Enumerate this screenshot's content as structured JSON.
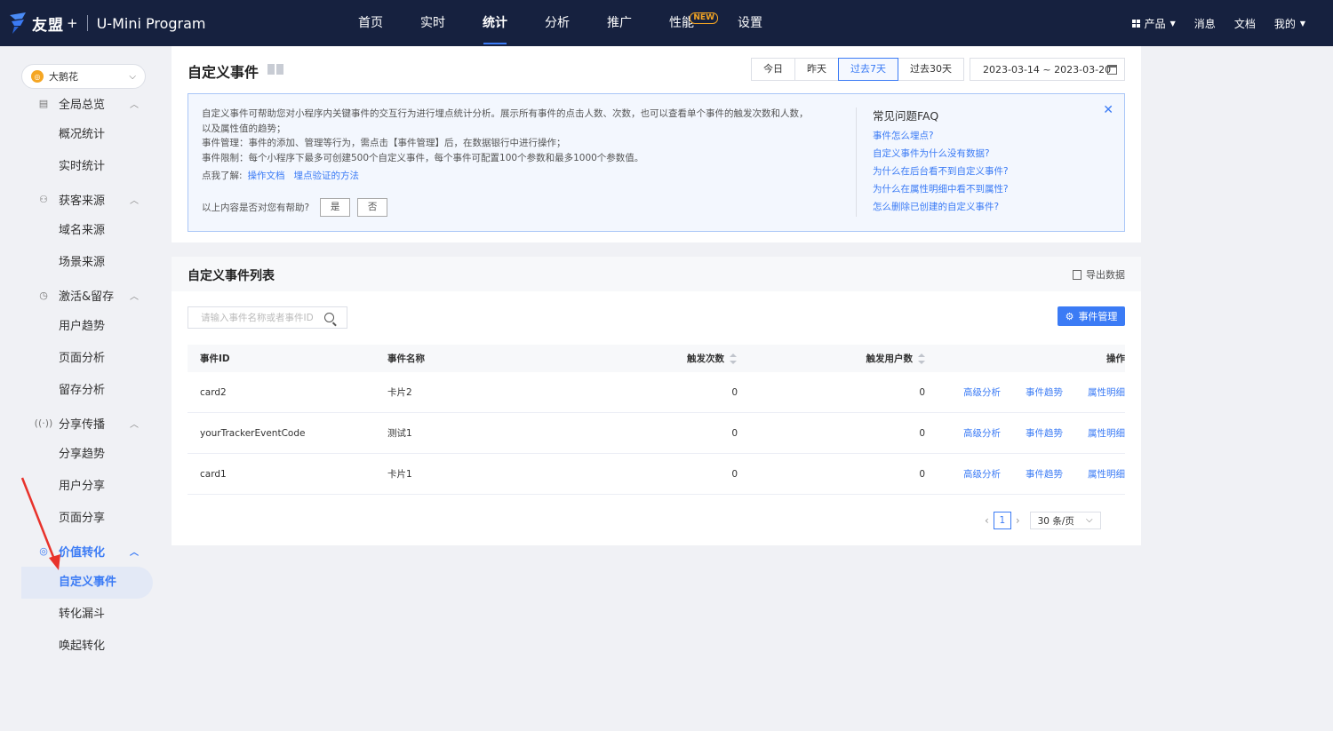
{
  "topbar": {
    "brand_name": "友盟",
    "brand_plus": "+",
    "product": "U-Mini Program",
    "nav": [
      {
        "label": "首页",
        "active": false
      },
      {
        "label": "实时",
        "active": false
      },
      {
        "label": "统计",
        "active": true
      },
      {
        "label": "分析",
        "active": false
      },
      {
        "label": "推广",
        "active": false
      },
      {
        "label": "性能",
        "active": false,
        "badge": "NEW"
      },
      {
        "label": "设置",
        "active": false
      }
    ],
    "right": {
      "products": "产品",
      "messages": "消息",
      "docs": "文档",
      "mine": "我的"
    }
  },
  "sidebar": {
    "app_name": "大鹅花",
    "groups": [
      {
        "label": "全局总览",
        "icon": "overview-icon",
        "items": [
          "概况统计",
          "实时统计"
        ]
      },
      {
        "label": "获客来源",
        "icon": "user-source-icon",
        "items": [
          "域名来源",
          "场景来源"
        ]
      },
      {
        "label": "激活&留存",
        "icon": "activation-icon",
        "items": [
          "用户趋势",
          "页面分析",
          "留存分析"
        ]
      },
      {
        "label": "分享传播",
        "icon": "share-icon",
        "items": [
          "分享趋势",
          "用户分享",
          "页面分享"
        ]
      },
      {
        "label": "价值转化",
        "icon": "value-icon",
        "items": [
          "自定义事件",
          "转化漏斗",
          "唤起转化"
        ]
      }
    ],
    "active_item": "自定义事件"
  },
  "header": {
    "title": "自定义事件",
    "date_tabs": [
      "今日",
      "昨天",
      "过去7天",
      "过去30天"
    ],
    "active_tab": "过去7天",
    "date_range": "2023-03-14 ~ 2023-03-20"
  },
  "info": {
    "lines": [
      "自定义事件可帮助您对小程序内关键事件的交互行为进行埋点统计分析。展示所有事件的点击人数、次数，也可以查看单个事件的触发次数和人数，以及属性值的趋势；",
      "事件管理：事件的添加、管理等行为，需点击【事件管理】后，在数据银行中进行操作；",
      "事件限制：每个小程序下最多可创建500个自定义事件，每个事件可配置100个参数和最多1000个参数值。"
    ],
    "learn_prefix": "点我了解:",
    "link_docs": "操作文档",
    "link_verify": "埋点验证的方法",
    "help_question": "以上内容是否对您有帮助?",
    "yes": "是",
    "no": "否",
    "faq_title": "常见问题FAQ",
    "faq": [
      "事件怎么埋点?",
      "自定义事件为什么没有数据?",
      "为什么在后台看不到自定义事件?",
      "为什么在属性明细中看不到属性?",
      "怎么删除已创建的自定义事件?"
    ]
  },
  "list": {
    "title": "自定义事件列表",
    "export": "导出数据",
    "search_placeholder": "请输入事件名称或者事件ID",
    "manage_button": "事件管理",
    "columns": {
      "id": "事件ID",
      "name": "事件名称",
      "count": "触发次数",
      "users": "触发用户数",
      "ops": "操作"
    },
    "rows": [
      {
        "id": "card2",
        "name": "卡片2",
        "count": "0",
        "users": "0"
      },
      {
        "id": "yourTrackerEventCode",
        "name": "测试1",
        "count": "0",
        "users": "0"
      },
      {
        "id": "card1",
        "name": "卡片1",
        "count": "0",
        "users": "0"
      }
    ],
    "ops": {
      "advanced": "高级分析",
      "trend": "事件趋势",
      "detail": "属性明细"
    },
    "pager": {
      "page": "1",
      "page_size": "30 条/页"
    }
  },
  "colors": {
    "accent": "#3b7bf5",
    "topbar": "#16213f",
    "badge": "#f5a623",
    "annotation_arrow": "#e8322b"
  }
}
